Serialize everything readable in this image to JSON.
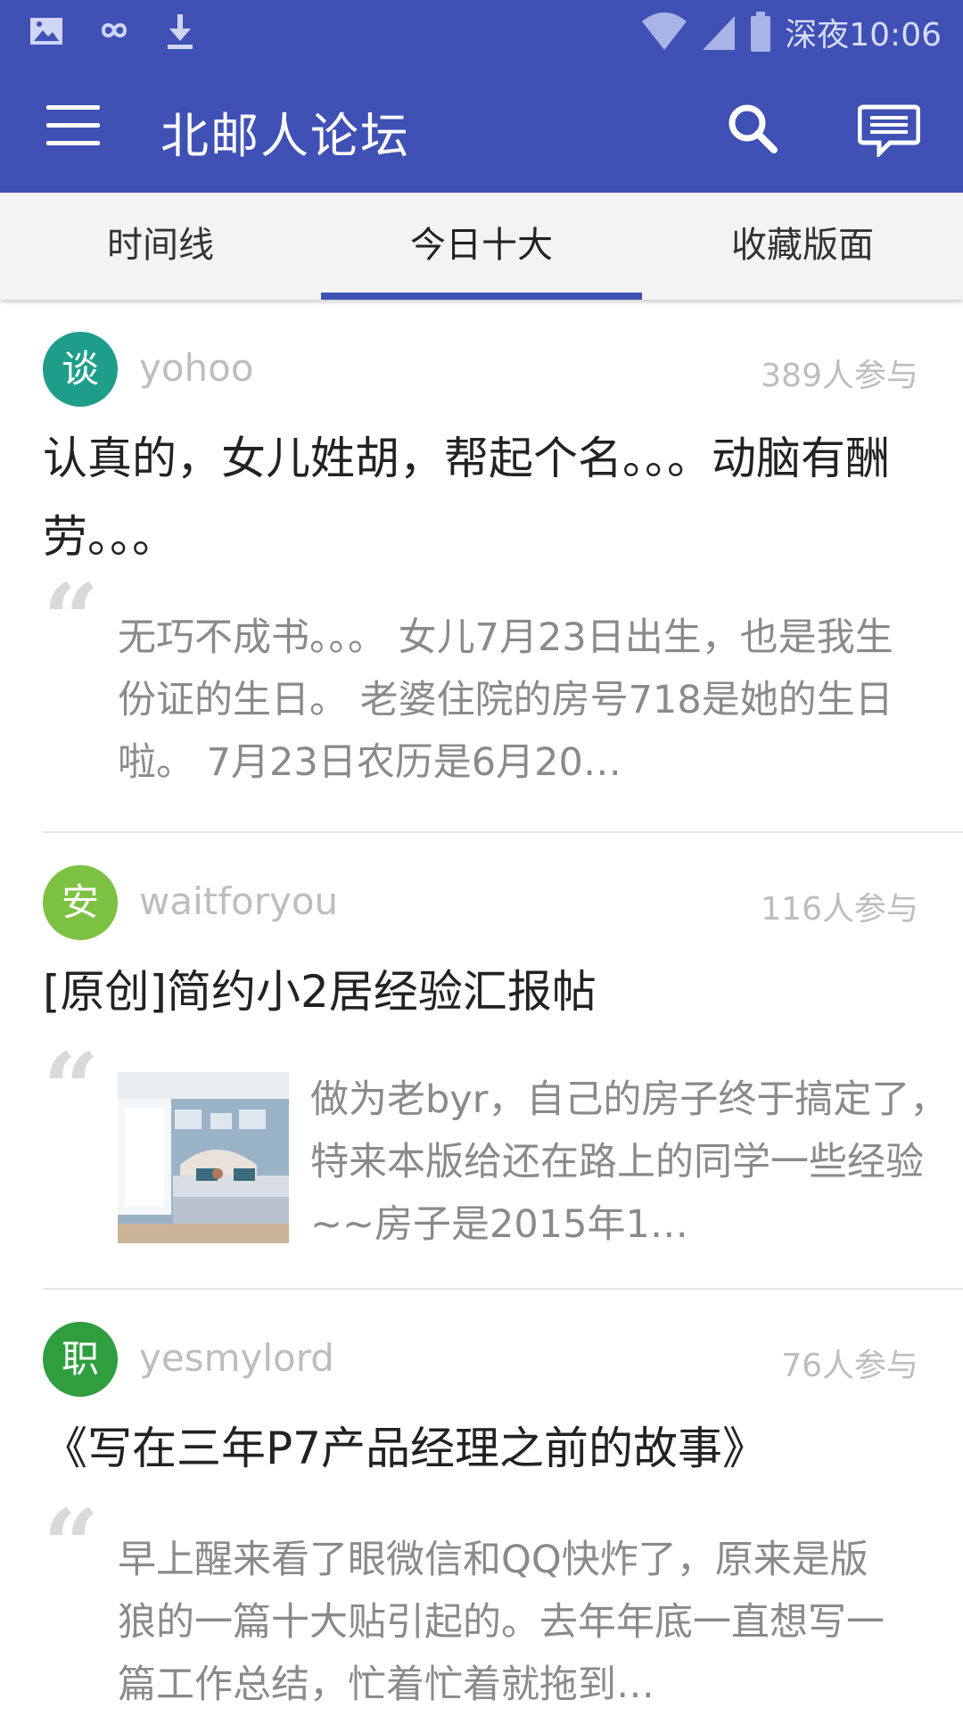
{
  "statusbar": {
    "time": "深夜10:06",
    "icons": [
      "image-icon",
      "infinity-icon",
      "download-icon",
      "wifi-icon",
      "signal-icon",
      "battery-icon"
    ]
  },
  "appbar": {
    "title": "北邮人论坛",
    "icons": [
      "menu-icon",
      "search-icon",
      "chat-icon"
    ],
    "color": "#3F51B5"
  },
  "tabs": [
    {
      "label": "时间线",
      "active": false
    },
    {
      "label": "今日十大",
      "active": true
    },
    {
      "label": "收藏版面",
      "active": false
    }
  ],
  "posts": [
    {
      "avatar_text": "谈",
      "avatar_color": "#1E9E8A",
      "username": "yohoo",
      "participants": "389人参与",
      "title": "认真的，女儿姓胡，帮起个名。。。动脑有酬劳。。。",
      "excerpt": "无巧不成书。。。 女儿7月23日出生，也是我生份证的生日。 老婆住院的房号718是她的生日啦。 7月23日农历是6月20…"
    },
    {
      "avatar_text": "安",
      "avatar_color": "#7DC142",
      "username": "waitforyou",
      "participants": "116人参与",
      "title": "[原创]简约小2居经验汇报帖",
      "excerpt": "做为老byr，自己的房子终于搞定了，特来本版给还在路上的同学一些经验~~房子是2015年1…"
    },
    {
      "avatar_text": "职",
      "avatar_color": "#2E9E3E",
      "username": "yesmylord",
      "participants": "76人参与",
      "title": "《写在三年P7产品经理之前的故事》",
      "excerpt": "早上醒来看了眼微信和QQ快炸了，原来是版狼的一篇十大贴引起的。去年年底一直想写一篇工作总结，忙着忙着就拖到…"
    }
  ]
}
